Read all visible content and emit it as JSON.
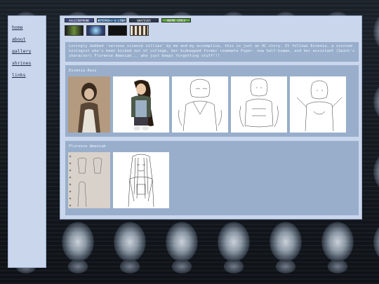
{
  "sidebar": {
    "links": [
      {
        "label": "home"
      },
      {
        "label": "about"
      },
      {
        "label": "gallery"
      },
      {
        "label": "shrines"
      },
      {
        "label": "links"
      }
    ]
  },
  "buttons": [
    {
      "label": "KALEIDOPHONE",
      "color": "#3c4a8c"
    },
    {
      "label": "NOTEPAD++ & LINUX",
      "color": "#2d6aa6"
    },
    {
      "label": "WHATEVER",
      "color": "#2a3b52"
    },
    {
      "label": "ANIME GIRLS",
      "color": "#5fa83c"
    }
  ],
  "intro": {
    "text": "Lovingly dubbed 'serious science sillies' by me and my accomplice, this is just an OC story. It follows Essenia, a scorned biologist who's been kicked out of college, her kidnapped former roommate Piper- now half-human, and her assistant (Saint's character) Florence Ameniah... who just keeps forgetting stuff!!!"
  },
  "gallery": [
    {
      "title": "Essenia Ross",
      "images": [
        "photo-sketch",
        "color-drawing",
        "lineart-1",
        "lineart-2",
        "lineart-3"
      ]
    },
    {
      "title": "Florence Ameniah",
      "images": [
        "notebook-sketch",
        "lineart-4"
      ]
    }
  ]
}
